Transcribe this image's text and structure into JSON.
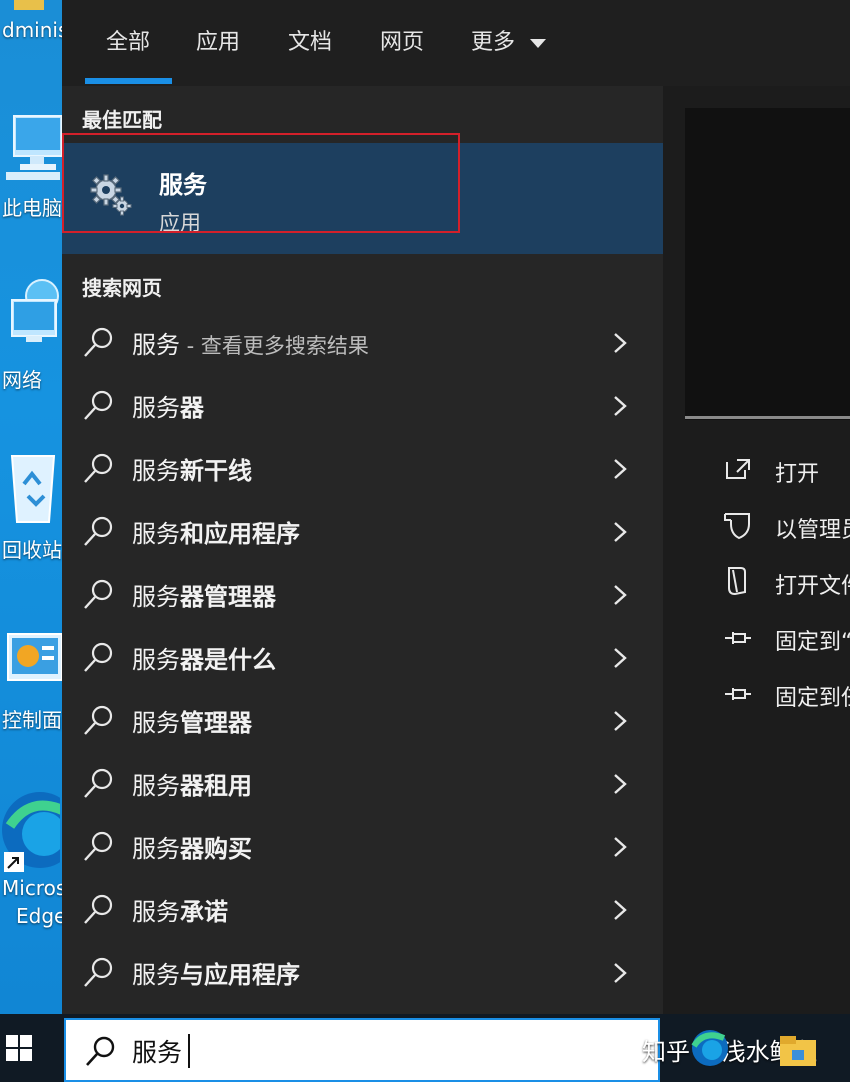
{
  "desktop": {
    "icons": [
      {
        "label": "dminis"
      },
      {
        "label": "此电脑"
      },
      {
        "label": "网络"
      },
      {
        "label": "回收站"
      },
      {
        "label": "控制面"
      },
      {
        "label": "Micros"
      },
      {
        "label": "Edge"
      }
    ]
  },
  "tabs": [
    {
      "label": "全部"
    },
    {
      "label": "应用"
    },
    {
      "label": "文档"
    },
    {
      "label": "网页"
    },
    {
      "label": "更多"
    }
  ],
  "active_tab": "全部",
  "best_match": {
    "section_title": "最佳匹配",
    "name": "服务",
    "type": "应用"
  },
  "web_search": {
    "section_title": "搜索网页",
    "items": [
      {
        "prefix": "服务",
        "suffix": "",
        "muted": " - 查看更多搜索结果"
      },
      {
        "prefix": "服务",
        "suffix": "器",
        "muted": ""
      },
      {
        "prefix": "服务",
        "suffix": "新干线",
        "muted": ""
      },
      {
        "prefix": "服务",
        "suffix": "和应用程序",
        "muted": ""
      },
      {
        "prefix": "服务",
        "suffix": "器管理器",
        "muted": ""
      },
      {
        "prefix": "服务",
        "suffix": "器是什么",
        "muted": ""
      },
      {
        "prefix": "服务",
        "suffix": "管理器",
        "muted": ""
      },
      {
        "prefix": "服务",
        "suffix": "器租用",
        "muted": ""
      },
      {
        "prefix": "服务",
        "suffix": "器购买",
        "muted": ""
      },
      {
        "prefix": "服务",
        "suffix": "承诺",
        "muted": ""
      },
      {
        "prefix": "服务",
        "suffix": "与应用程序",
        "muted": ""
      }
    ]
  },
  "actions": [
    {
      "label": "打开",
      "icon": "open-icon"
    },
    {
      "label": "以管理员",
      "icon": "shield-icon"
    },
    {
      "label": "打开文件",
      "icon": "file-location-icon"
    },
    {
      "label": "固定到“",
      "icon": "pin-icon"
    },
    {
      "label": "固定到任",
      "icon": "pin-icon"
    }
  ],
  "search": {
    "value": "服务"
  },
  "watermark": "知乎 @浅水鲤鱼",
  "colors": {
    "accent": "#1a8fe6",
    "highlight": "#1d3f5f",
    "outline": "#d3202a"
  }
}
